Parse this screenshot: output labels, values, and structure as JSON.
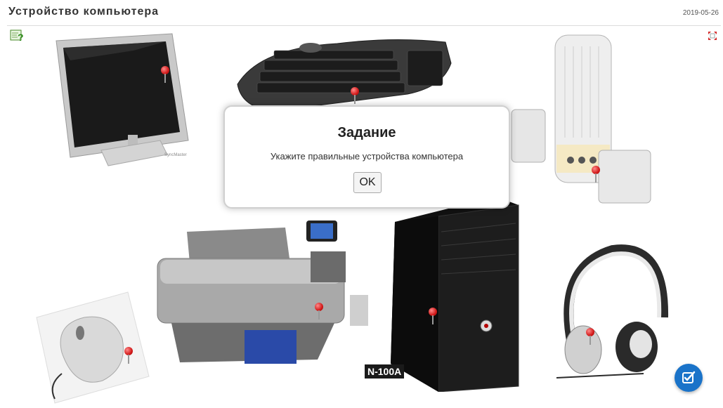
{
  "header": {
    "title": "Устройство компьютера",
    "date": "2019-05-26"
  },
  "toolbar": {
    "help_icon": "help-question-icon",
    "fullscreen_icon": "fullscreen-icon"
  },
  "dialog": {
    "title": "Задание",
    "message": "Укажите правильные устройства компьютера",
    "ok_label": "OK"
  },
  "devices": {
    "monitor": "monitor",
    "keyboard": "keyboard",
    "speakers": "speakers",
    "printer": "printer",
    "system_unit": "system-unit",
    "system_unit_label": "N-100A",
    "mouse": "mouse",
    "headphones": "headphones"
  },
  "check_button": {
    "icon": "check-edit-icon",
    "color": "#1a73c9"
  },
  "colors": {
    "pin": "#d21a1a",
    "accent": "#1a73c9"
  }
}
